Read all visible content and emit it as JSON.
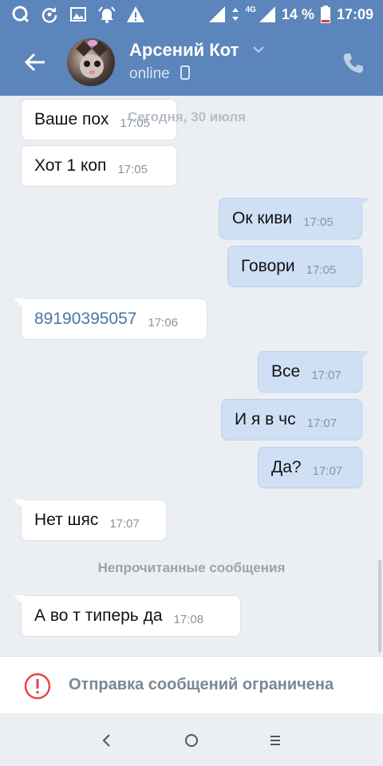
{
  "status_bar": {
    "battery_percent": "14 %",
    "network": "4G",
    "time": "17:09"
  },
  "header": {
    "contact_name": "Арсений Кот",
    "status": "online"
  },
  "chat": {
    "date_label": "Сегодня, 30 июля",
    "messages": [
      {
        "direction": "in",
        "text": "Ваше пох",
        "time": "17:05"
      },
      {
        "direction": "in",
        "text": "Хот 1 коп",
        "time": "17:05"
      },
      {
        "direction": "out",
        "text": "Ок киви",
        "time": "17:05"
      },
      {
        "direction": "out",
        "text": "Говори",
        "time": "17:05"
      },
      {
        "direction": "in",
        "text": "89190395057",
        "time": "17:06"
      },
      {
        "direction": "out",
        "text": "Все",
        "time": "17:07"
      },
      {
        "direction": "out",
        "text": "И я в чс",
        "time": "17:07"
      },
      {
        "direction": "out",
        "text": "Да?",
        "time": "17:07"
      },
      {
        "direction": "in",
        "text": "Нет шяс",
        "time": "17:07"
      },
      {
        "direction": "in",
        "text": "А во т типерь да",
        "time": "17:08"
      }
    ],
    "unread_label": "Непрочитанные сообщения"
  },
  "restriction": {
    "text": "Отправка сообщений ограничена"
  },
  "colors": {
    "header_bg": "#5b85bb",
    "out_bubble": "#cfe0f5",
    "in_bubble": "#ffffff",
    "chat_bg": "#ebeef2",
    "link": "#4a76a8",
    "warning": "#e64646"
  },
  "icons": {
    "status_left": [
      "q-icon",
      "sync-icon",
      "image-icon",
      "alarm-icon",
      "warning-icon"
    ],
    "status_right": [
      "signal-icon",
      "data-arrows-icon",
      "signal-icon",
      "battery-icon"
    ],
    "header": [
      "back-arrow-icon",
      "chevron-down-icon",
      "phone-icon",
      "call-icon"
    ],
    "nav": [
      "nav-back-icon",
      "nav-home-icon",
      "nav-menu-icon"
    ]
  }
}
